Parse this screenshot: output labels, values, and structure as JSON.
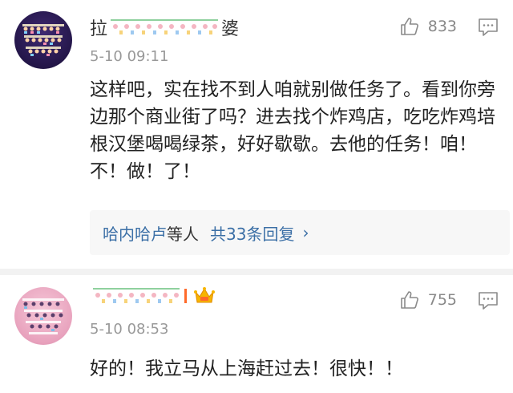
{
  "comments": [
    {
      "name_prefix": "拉",
      "name_suffix": "婆",
      "time": "5-10 09:11",
      "likes": "833",
      "text": "这样吧，实在找不到人咱就别做任务了。看到你旁边那个商业街了吗？进去找个炸鸡店，吃吃炸鸡培根汉堡喝喝绿茶，好好歇歇。去他的任务！咱！不！做！了！",
      "replies": {
        "user": "哈内哈卢",
        "mid": "等人",
        "total": "共33条回复",
        "chevron": "›"
      }
    },
    {
      "time": "5-10 08:53",
      "likes": "755",
      "text": "好的！我立马从上海赶过去！很快！！"
    }
  ],
  "colors": {
    "link": "#3b6fa6",
    "meta": "#999999",
    "vip": "#ff6a2a"
  },
  "icons": [
    "thumbs-up-icon",
    "reply-icon",
    "vip-crown-icon"
  ]
}
